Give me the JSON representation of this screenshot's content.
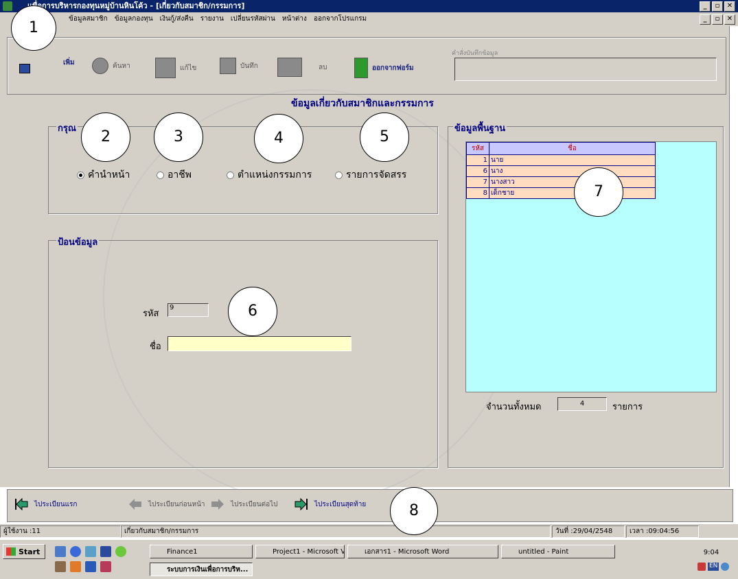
{
  "window": {
    "title": "แพื่อการบริหารกองทุนหมู่บ้านหินโค้ว - [เกี่ยวกับสมาชิก/กรรมการ]",
    "buttons": [
      "_",
      "▫",
      "✕"
    ]
  },
  "menu": [
    "ข้อมูลสมาชิก",
    "ข้อมูลกองทุน",
    "เงินกู้/ส่งคืน",
    "รายงาน",
    "เปลี่ยนรหัสผ่าน",
    "หน้าต่าง",
    "ออกจากโปรแกรม"
  ],
  "toolbar": {
    "add": "เพิ่ม",
    "search": "ค้นหา",
    "edit": "แก้ไข",
    "save": "บันทึก",
    "delete": "ลบ",
    "exit": "ออกจากฟอร์ม",
    "save_status_label": "คำสั่งบันทึกข้อมูล"
  },
  "form": {
    "heading": "ข้อมูลเกี่ยวกับสมาชิกและกรรมการ",
    "group_label": "กรุณ",
    "radios": [
      "คำนำหน้า",
      "อาชีพ",
      "ตำแหน่งกรรมการ",
      "รายการจัดสรร"
    ],
    "selected_radio": 0,
    "entry_label": "ป้อนข้อมูล",
    "code_label": "รหัส",
    "code_value": "9",
    "name_label": "ชื่อ",
    "name_value": ""
  },
  "base_data": {
    "label": "ข้อมูลพื้นฐาน",
    "columns": [
      "รหัส",
      "ชื่อ"
    ],
    "rows": [
      [
        "1",
        "นาย"
      ],
      [
        "6",
        "นาง"
      ],
      [
        "7",
        "นางสาว"
      ],
      [
        "8",
        "เด็กชาย"
      ]
    ],
    "total_label": "จำนวนทั้งหมด",
    "total_value": "4",
    "total_unit": "รายการ"
  },
  "nav": {
    "first": "ไประเบียนแรก",
    "prev": "ไประเบียนก่อนหน้า",
    "next": "ไประเบียนต่อไป",
    "last": "ไประเบียนสุดท้าย"
  },
  "status": {
    "user": "ผู้ใช้งาน :11",
    "form": "เกี่ยวกับสมาชิก/กรรมการ",
    "date": "วันที่ :29/04/2548",
    "time": "เวลา :09:04:56"
  },
  "taskbar": {
    "start": "Start",
    "tasks": [
      "Finance1",
      "Project1 - Microsoft Visual...",
      "เอกสาร1 - Microsoft Word",
      "untitled - Paint",
      "ระบบการเงินเพื่อการบริห..."
    ],
    "clock": "9:04",
    "lang": "EN"
  },
  "callouts": [
    "1",
    "2",
    "3",
    "4",
    "5",
    "6",
    "7",
    "8"
  ],
  "colors": {
    "titlebar": "#0a246a",
    "face": "#d4d0c8",
    "accent": "#000080",
    "grid_bg": "#b7ffff",
    "row_bg": "#ffdcc0",
    "name_input": "#ffffc8"
  }
}
